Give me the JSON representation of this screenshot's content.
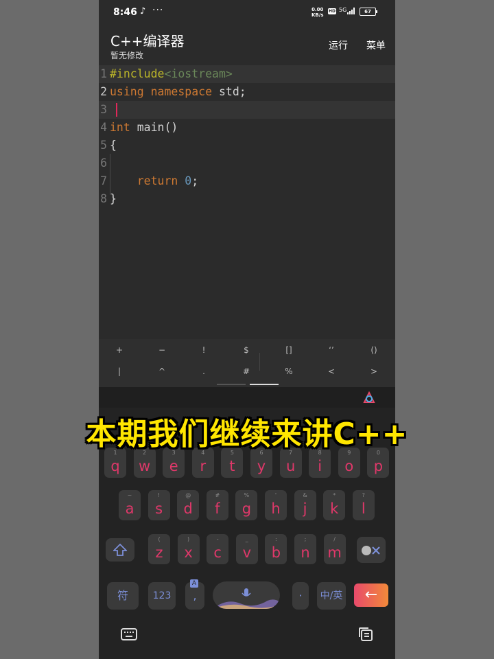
{
  "status": {
    "time": "8:46",
    "speed_value": "0.00",
    "speed_unit": "KB/s",
    "hd": "HD",
    "network": "5G",
    "battery": "67"
  },
  "appbar": {
    "title": "C++编译器",
    "subtitle": "暂无修改",
    "run_label": "运行",
    "menu_label": "菜单"
  },
  "editor": {
    "lines": [
      {
        "n": "1",
        "tokens": [
          {
            "t": "#include",
            "c": "inc"
          },
          {
            "t": "<iostream>",
            "c": "hdr"
          }
        ]
      },
      {
        "n": "2",
        "tokens": [
          {
            "t": "using namespace",
            "c": "kw"
          },
          {
            "t": " std;",
            "c": "pl"
          }
        ]
      },
      {
        "n": "3",
        "tokens": []
      },
      {
        "n": "4",
        "tokens": [
          {
            "t": "int",
            "c": "kw"
          },
          {
            "t": " main()",
            "c": "pl"
          }
        ]
      },
      {
        "n": "5",
        "tokens": [
          {
            "t": "{",
            "c": "pl"
          }
        ]
      },
      {
        "n": "6",
        "tokens": []
      },
      {
        "n": "7",
        "tokens": [
          {
            "t": "    return",
            "c": "kw"
          },
          {
            "t": " 0",
            "c": "num"
          },
          {
            "t": ";",
            "c": "pl"
          }
        ]
      },
      {
        "n": "8",
        "tokens": [
          {
            "t": "}",
            "c": "pl"
          }
        ]
      }
    ]
  },
  "symbols": {
    "row1": [
      "+",
      "−",
      "!",
      "$",
      "[]",
      "‘’",
      "()"
    ],
    "row2": [
      "|",
      "^",
      ".",
      "#",
      "%",
      "<",
      ">"
    ]
  },
  "keyboard": {
    "row1": [
      {
        "k": "q",
        "h": "1"
      },
      {
        "k": "w",
        "h": "2"
      },
      {
        "k": "e",
        "h": "3"
      },
      {
        "k": "r",
        "h": "4"
      },
      {
        "k": "t",
        "h": "5"
      },
      {
        "k": "y",
        "h": "6"
      },
      {
        "k": "u",
        "h": "7"
      },
      {
        "k": "i",
        "h": "8"
      },
      {
        "k": "o",
        "h": "9"
      },
      {
        "k": "p",
        "h": "0"
      }
    ],
    "row2": [
      {
        "k": "a",
        "h": "~"
      },
      {
        "k": "s",
        "h": "!"
      },
      {
        "k": "d",
        "h": "@"
      },
      {
        "k": "f",
        "h": "#"
      },
      {
        "k": "g",
        "h": "%"
      },
      {
        "k": "h",
        "h": "'"
      },
      {
        "k": "j",
        "h": "&"
      },
      {
        "k": "k",
        "h": "*"
      },
      {
        "k": "l",
        "h": "?"
      }
    ],
    "row3": [
      {
        "k": "z",
        "h": "("
      },
      {
        "k": "x",
        "h": ")"
      },
      {
        "k": "c",
        "h": "-"
      },
      {
        "k": "v",
        "h": "_"
      },
      {
        "k": "b",
        "h": ":"
      },
      {
        "k": "n",
        "h": ";"
      },
      {
        "k": "m",
        "h": "/"
      }
    ],
    "symbols_key": "符",
    "numbers_key": "123",
    "comma_key": ",",
    "comma_badge": "A",
    "period_key": "·",
    "lang_key": "中/英",
    "enter_key": "←"
  },
  "caption": "本期我们继续来讲C++",
  "colors": {
    "key_text": "#e0386a",
    "caption": "#ffe600",
    "cursor": "#e0285a"
  }
}
